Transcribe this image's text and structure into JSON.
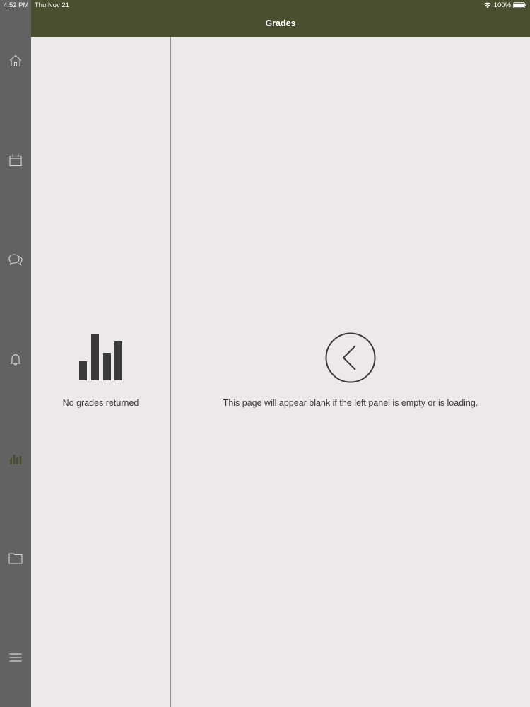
{
  "status_bar": {
    "time": "4:52 PM",
    "date": "Thu Nov 21",
    "battery": "100%"
  },
  "header": {
    "title": "Grades"
  },
  "sidebar": {
    "items": [
      {
        "id": "home",
        "icon": "home-icon"
      },
      {
        "id": "calendar",
        "icon": "calendar-icon"
      },
      {
        "id": "messages",
        "icon": "chat-bubbles-icon"
      },
      {
        "id": "notifications",
        "icon": "bell-icon"
      },
      {
        "id": "grades",
        "icon": "bar-chart-icon",
        "active": true
      },
      {
        "id": "files",
        "icon": "folder-icon"
      },
      {
        "id": "menu",
        "icon": "hamburger-menu-icon"
      }
    ]
  },
  "left_panel": {
    "empty_message": "No grades returned",
    "icon": "bar-chart-icon"
  },
  "right_panel": {
    "message": "This page will appear blank if the left panel is empty or is loading.",
    "icon": "chevron-left-circle-icon"
  },
  "colors": {
    "header_bg": "#4a4f30",
    "sidebar_bg": "#636263",
    "active_icon": "#4a4f30",
    "panel_bg": "#ebe9ea"
  }
}
